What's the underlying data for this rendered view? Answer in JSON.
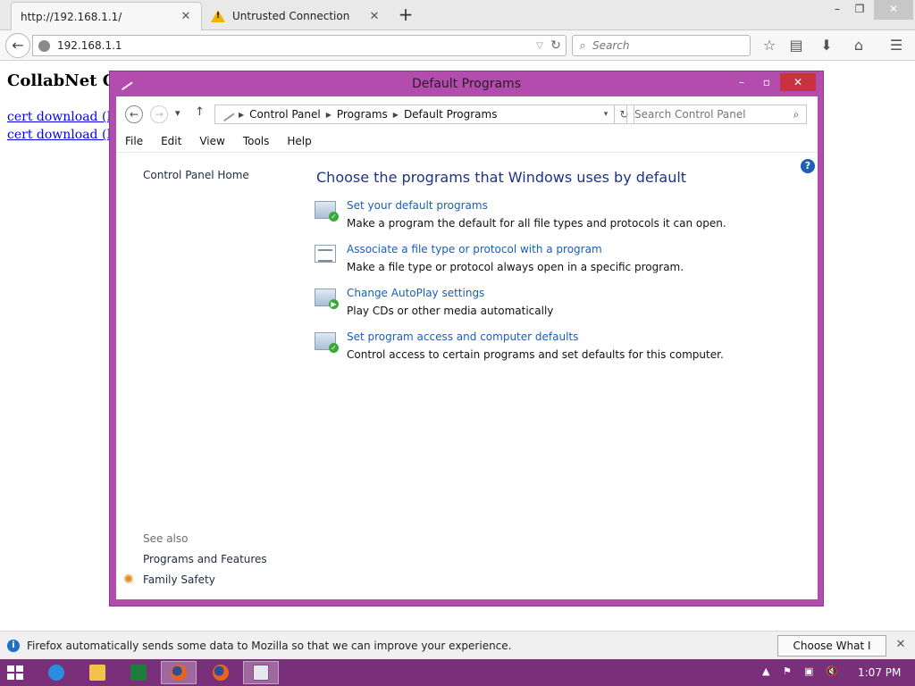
{
  "browser": {
    "tabs": [
      {
        "title": "http://192.168.1.1/"
      },
      {
        "title": "Untrusted Connection"
      }
    ],
    "url": "192.168.1.1",
    "search_placeholder": "Search"
  },
  "page": {
    "heading": "CollabNet Cer",
    "links": [
      "cert download (DE",
      "cert download (PE"
    ]
  },
  "cp": {
    "title": "Default Programs",
    "breadcrumbs": [
      "Control Panel",
      "Programs",
      "Default Programs"
    ],
    "search_placeholder": "Search Control Panel",
    "menu": [
      "File",
      "Edit",
      "View",
      "Tools",
      "Help"
    ],
    "sidebar": {
      "home": "Control Panel Home",
      "see_also": "See also",
      "links": [
        "Programs and Features",
        "Family Safety"
      ]
    },
    "main_title": "Choose the programs that Windows uses by default",
    "tasks": [
      {
        "link": "Set your default programs",
        "desc": "Make a program the default for all file types and protocols it can open."
      },
      {
        "link": "Associate a file type or protocol with a program",
        "desc": "Make a file type or protocol always open in a specific program."
      },
      {
        "link": "Change AutoPlay settings",
        "desc": "Play CDs or other media automatically"
      },
      {
        "link": "Set program access and computer defaults",
        "desc": "Control access to certain programs and set defaults for this computer."
      }
    ]
  },
  "notification": {
    "text": "Firefox automatically sends some data to Mozilla so that we can improve your experience.",
    "button": "Choose What I Share"
  },
  "taskbar": {
    "time": "1:07 PM"
  },
  "colors": {
    "window_accent": "#b24dae",
    "taskbar": "#7a2f7a",
    "link": "#1a5fb4"
  }
}
